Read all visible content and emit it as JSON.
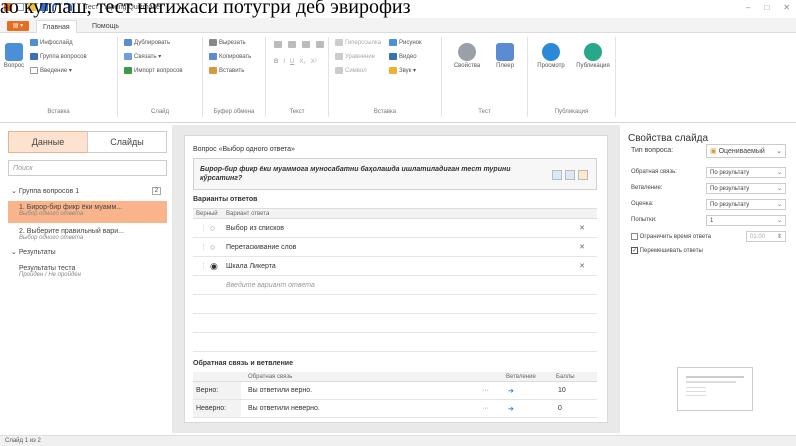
{
  "overlay_text": "ао куллаш, тест натижаси потугри деб эвирофиз",
  "window": {
    "title": "Тест - iSpring Quizmaker",
    "minimize": "–",
    "maximize": "□",
    "close": "✕"
  },
  "tabs": {
    "file": "▤ ▾",
    "home": "Главная",
    "help": "Помощь"
  },
  "ribbon": {
    "insert": {
      "label": "Вставка",
      "question": "Вопрос",
      "infoslide": "Инфослайд",
      "group": "Группа вопросов",
      "intro": "Введение ▾"
    },
    "slide": {
      "label": "Слайд",
      "duplicate": "Дублировать",
      "link": "Связать ▾",
      "import": "Импорт вопросов"
    },
    "clipboard": {
      "label": "Буфер обмена",
      "cut": "Вырезать",
      "copy": "Копировать",
      "paste": "Вставить"
    },
    "text": {
      "label": "Текст",
      "bold": "B",
      "italic": "I",
      "underline": "U",
      "sub": "X₂",
      "sup": "X²"
    },
    "insert2": {
      "label": "Вставка",
      "hyperlink": "Гиперссылка",
      "equation": "Уравнение",
      "symbol": "Символ",
      "picture": "Рисунок",
      "video": "Видео",
      "sound": "Звук ▾"
    },
    "test": {
      "label": "Тест",
      "properties": "Свойства",
      "player": "Плеер"
    },
    "publish": {
      "label": "Публикация",
      "preview": "Просмотр",
      "publish": "Публикация"
    }
  },
  "left": {
    "data_tab": "Данные",
    "slides_tab": "Слайды",
    "search_placeholder": "Поиск",
    "group_label": "Группа вопросов 1",
    "group_count": "2",
    "items": [
      {
        "title": "1. Бирор-бир фикр ёки муамм...",
        "sub": "Выбор одного ответа"
      },
      {
        "title": "2. Выберите правильный вари...",
        "sub": "Выбор одного ответа"
      }
    ],
    "results_label": "Результаты",
    "results_item": {
      "title": "Результаты теста",
      "sub": "Пройден / Не пройден"
    }
  },
  "editor": {
    "header": "Вопрос «Выбор одного ответа»",
    "question": "Бирор-бир фикр ёки муаммога муносабатни баҳолашда ишлатиладиган тест турини кўрсатинг?",
    "answers_title": "Варианты ответов",
    "col_correct": "Верный",
    "col_variant": "Вариант ответа",
    "answers": [
      {
        "text": "Выбор из списков",
        "selected": false
      },
      {
        "text": "Перетаскивание слов",
        "selected": false
      },
      {
        "text": "Шкала Ликерта",
        "selected": true
      }
    ],
    "new_answer_placeholder": "Введите вариант ответа",
    "feedback_title": "Обратная связь и ветвление",
    "fb_col_feedback": "Обратная связь",
    "fb_col_branch": "Ветвление",
    "fb_col_points": "Баллы",
    "feedback": [
      {
        "label": "Верно:",
        "text": "Вы ответили верно.",
        "points": "10"
      },
      {
        "label": "Неверно:",
        "text": "Вы ответили неверно.",
        "points": "0"
      }
    ]
  },
  "props": {
    "title": "Свойства слайда",
    "qtype_label": "Тип вопроса:",
    "qtype_value": "Оцениваемый",
    "feedback_label": "Обратная связь:",
    "feedback_value": "По результату",
    "branch_label": "Ветвление:",
    "branch_value": "По результату",
    "score_label": "Оценка:",
    "score_value": "По результату",
    "attempts_label": "Попытки:",
    "attempts_value": "1",
    "limit_label": "Ограничить время ответа",
    "limit_value": "01:00",
    "shuffle_label": "Перемешивать ответы"
  },
  "status": "Слайд 1 из 2",
  "colors": {
    "accent": "#e86d1f",
    "selected": "#f9b48b",
    "link_arrow": "#2b7bd3"
  }
}
